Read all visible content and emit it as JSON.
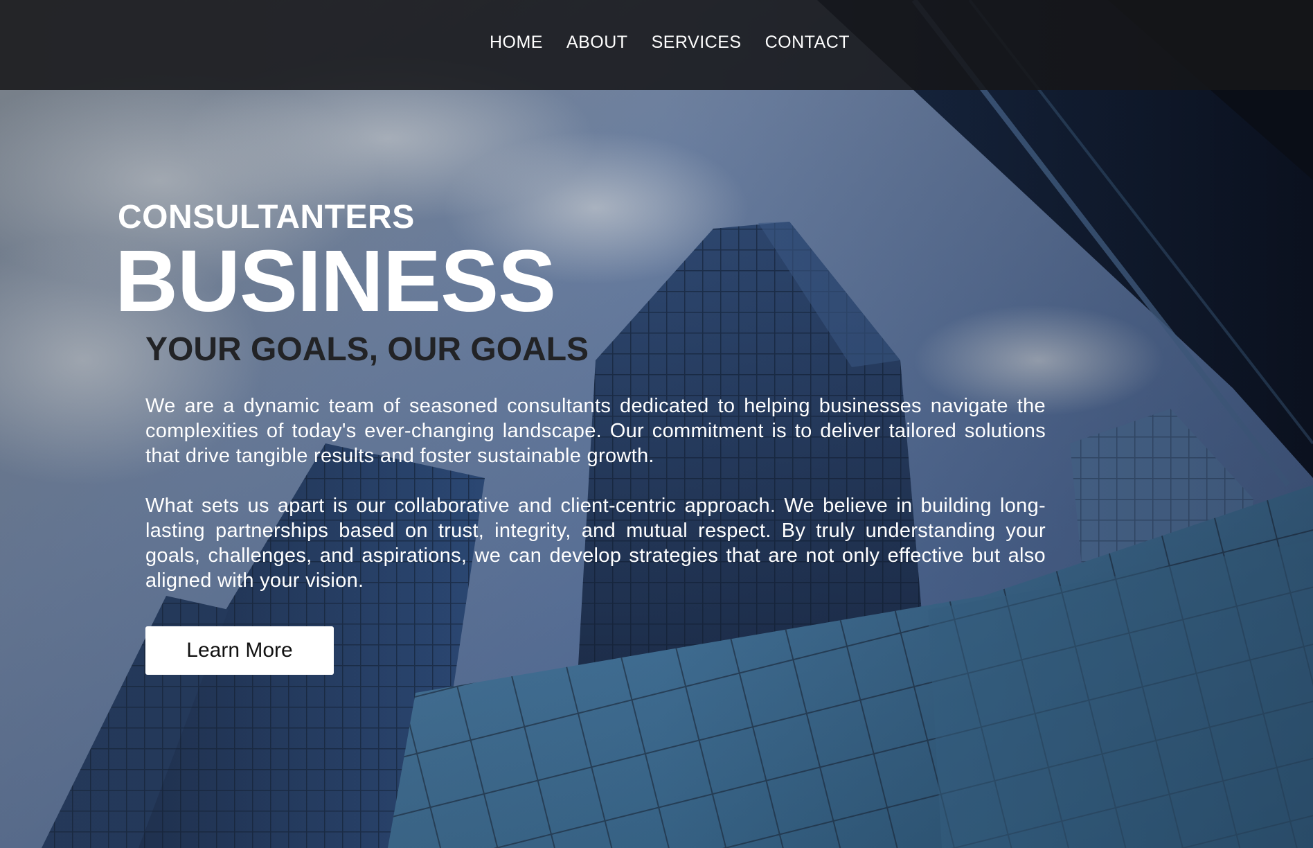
{
  "nav": {
    "items": [
      {
        "label": "HOME"
      },
      {
        "label": "ABOUT"
      },
      {
        "label": "SERVICES"
      },
      {
        "label": "CONTACT"
      }
    ]
  },
  "hero": {
    "eyebrow": "CONSULTANTERS",
    "title": "BUSINESS",
    "subtitle": "YOUR GOALS, OUR GOALS",
    "paragraphs": [
      "We are a dynamic team of seasoned consultants dedicated to helping businesses navigate the complexities of today's ever-changing landscape. Our commitment is to deliver tailored solutions that drive tangible results and foster sustainable growth.",
      "What sets us apart is our collaborative and client-centric approach. We believe in building long-lasting partnerships based on trust, integrity, and mutual respect. By truly understanding your goals, challenges, and aspirations, we can develop strategies that are not only effective but also aligned with your vision."
    ],
    "cta_label": "Learn More"
  },
  "colors": {
    "nav_background": "#161618",
    "subtitle_text": "#222326",
    "button_background": "#ffffff"
  }
}
